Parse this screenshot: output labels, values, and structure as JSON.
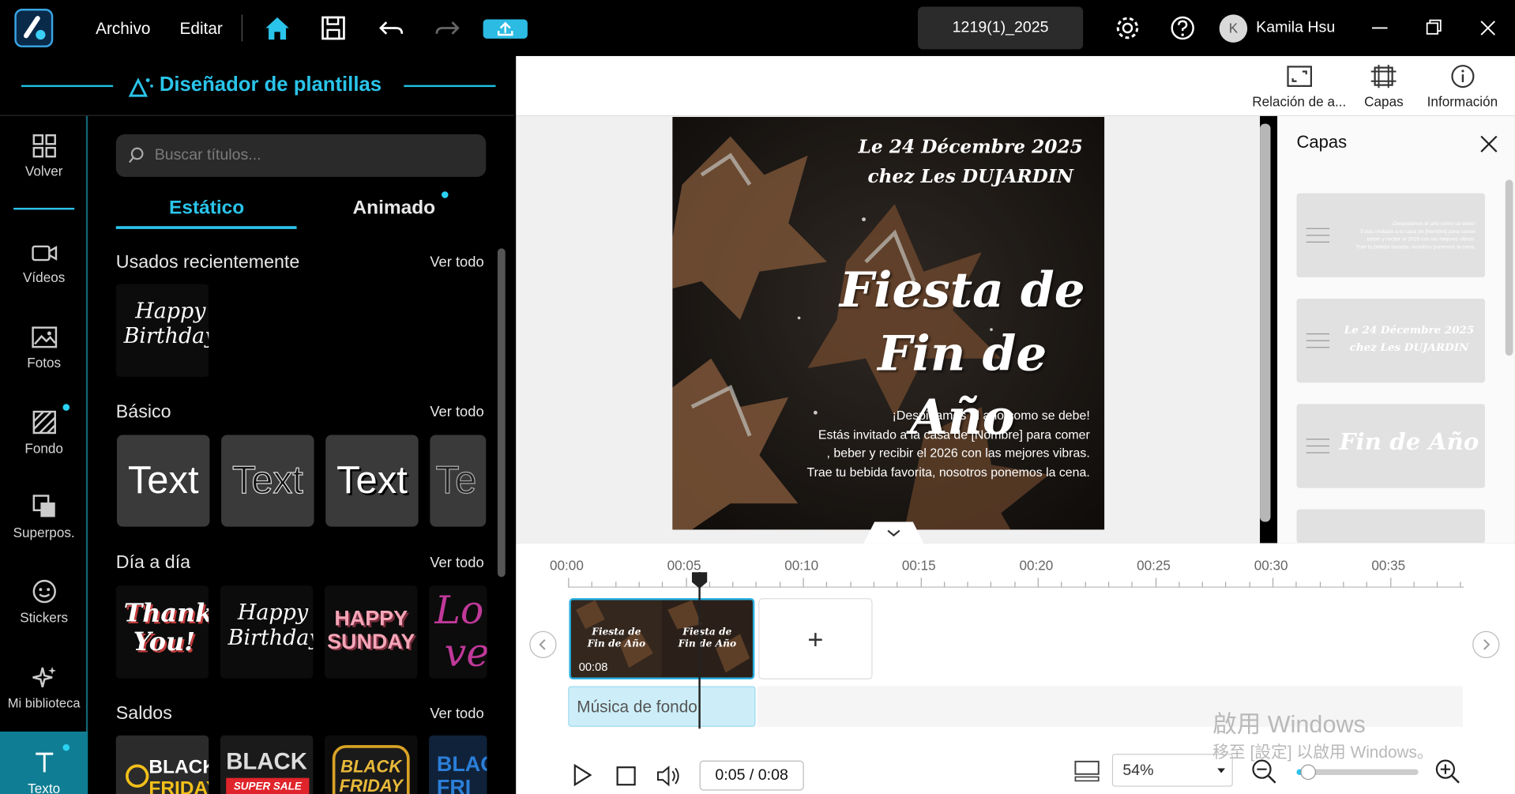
{
  "titlebar": {
    "menu_file": "Archivo",
    "menu_edit": "Editar",
    "project_name": "1219(1)_2025",
    "user_initial": "K",
    "user_name": "Kamila Hsu"
  },
  "left_panel": {
    "title": "Diseñador de plantillas",
    "nav": [
      {
        "label": "Volver",
        "icon": "grid-icon"
      },
      {
        "label": "Vídeos",
        "icon": "video-camera-icon"
      },
      {
        "label": "Fotos",
        "icon": "image-icon"
      },
      {
        "label": "Fondo",
        "icon": "background-hatch-icon"
      },
      {
        "label": "Superpos.",
        "icon": "overlay-icon"
      },
      {
        "label": "Stickers",
        "icon": "sticker-icon"
      },
      {
        "label": "Mi biblioteca",
        "icon": "sparkle-icon"
      },
      {
        "label": "Texto",
        "icon": "text-icon"
      }
    ],
    "search_placeholder": "Buscar títulos...",
    "tabs": [
      "Estático",
      "Animado"
    ],
    "see_all": "Ver todo",
    "sections": {
      "recent": {
        "title": "Usados recientemente",
        "items": [
          [
            "Happy",
            "Birthday"
          ]
        ]
      },
      "basic": {
        "title": "Básico",
        "items": [
          "Text",
          "Text",
          "Text",
          "Te"
        ]
      },
      "daily": {
        "title": "Día a día",
        "items": [
          [
            "Thank",
            "You!"
          ],
          [
            "Happy",
            "Birthday"
          ],
          [
            "HAPPY",
            "SUNDAY"
          ],
          [
            "Lo",
            "ve"
          ]
        ]
      },
      "sales": {
        "title": "Saldos",
        "items": [
          [
            "BLACK",
            "FRIDAY"
          ],
          [
            "BLACK",
            "SUPER SALE"
          ],
          [
            "BLACK",
            "FRIDAY"
          ],
          [
            "BLAC",
            "FRI"
          ]
        ]
      }
    }
  },
  "toolbar_right": {
    "aspect": "Relación de a...",
    "layers": "Capas",
    "info": "Información"
  },
  "canvas": {
    "date_line1": "Le 24 Décembre 2025",
    "date_line2": "chez Les DUJARDIN",
    "headline1": "Fiesta de",
    "headline2": "Fin de Año",
    "body": [
      "¡Despidamos el año como se debe!",
      "Estás invitado a la casa de [Nombre] para comer",
      ", beber y recibir el 2026 con las mejores vibras.",
      "Trae tu bebida favorita, nosotros ponemos la cena."
    ]
  },
  "layers_panel": {
    "title": "Capas",
    "items": [
      {
        "text": [
          "¡Despidamos el año como se debe!",
          "Estás invitado a la casa de [Nombre] para comer",
          ", beber y recibir el 2026 con las mejores vibras.",
          "Trae tu bebida favorita, nosotros ponemos la cena."
        ]
      },
      {
        "text": [
          "Le 24 Décembre 2025",
          "chez Les DUJARDIN"
        ]
      },
      {
        "text": [
          "Fin de Año"
        ]
      }
    ]
  },
  "timeline": {
    "ticks": [
      "00:00",
      "00:05",
      "00:10",
      "00:15",
      "00:20",
      "00:25",
      "00:30",
      "00:35"
    ],
    "clip_duration": "00:08",
    "clip_thumb_line1": "Fiesta de",
    "clip_thumb_line2": "Fin de Año",
    "music_label": "Música de fondo",
    "time_display": "0:05 / 0:08",
    "zoom": "54%",
    "zoom_level": 0.05
  },
  "watermark": {
    "line1": "啟用 Windows",
    "line2": "移至 [設定] 以啟用 Windows。"
  },
  "colors": {
    "accent": "#2ac4ea",
    "nav_active": "#0f7e94",
    "clip_border": "#24aee0"
  }
}
